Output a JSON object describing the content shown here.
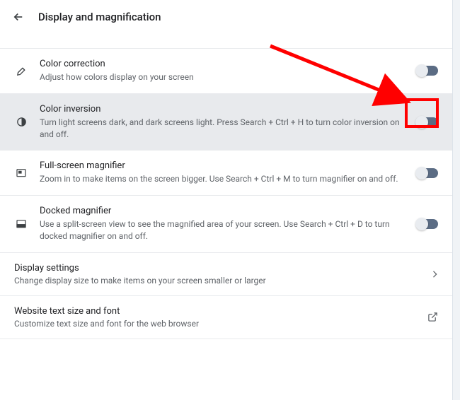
{
  "header": {
    "title": "Display and magnification"
  },
  "rows": {
    "color_correction": {
      "title": "Color correction",
      "desc": "Adjust how colors display on your screen"
    },
    "color_inversion": {
      "title": "Color inversion",
      "desc": "Turn light screens dark, and dark screens light. Press Search + Ctrl + H to turn color inversion on and off."
    },
    "fullscreen_magnifier": {
      "title": "Full-screen magnifier",
      "desc": "Zoom in to make items on the screen bigger. Use Search + Ctrl + M to turn magnifier on and off."
    },
    "docked_magnifier": {
      "title": "Docked magnifier",
      "desc": "Use a split-screen view to see the magnified area of your screen. Use Search + Ctrl + D to turn docked magnifier on and off."
    }
  },
  "links": {
    "display_settings": {
      "title": "Display settings",
      "desc": "Change display size to make items on your screen smaller or larger"
    },
    "website_text": {
      "title": "Website text size and font",
      "desc": "Customize text size and font for the web browser"
    }
  },
  "annotation": {
    "arrow_color": "#ff0000",
    "box_color": "#ff0000"
  }
}
